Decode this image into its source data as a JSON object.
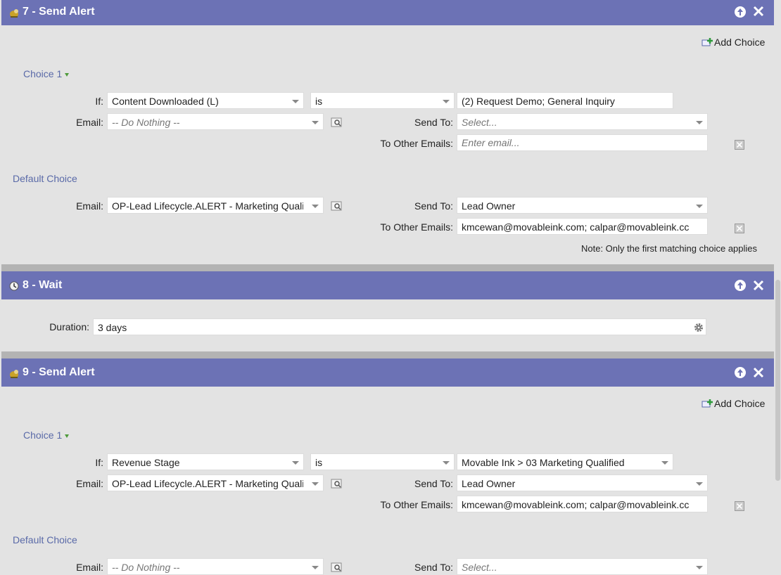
{
  "steps": [
    {
      "title": "7 - Send Alert",
      "add_choice": "Add Choice",
      "choice1": {
        "label": "Choice 1",
        "if_label": "If:",
        "attribute": "Content Downloaded (L)",
        "operator": "is",
        "value": "(2) Request Demo; General Inquiry",
        "email_label": "Email:",
        "email_value": "-- Do Nothing --",
        "send_to_label": "Send To:",
        "send_to_value": "Select...",
        "other_emails_label": "To Other Emails:",
        "other_emails_placeholder": "Enter email..."
      },
      "default_choice": {
        "label": "Default Choice",
        "email_label": "Email:",
        "email_value": "OP-Lead Lifecycle.ALERT - Marketing Qualif",
        "send_to_label": "Send To:",
        "send_to_value": "Lead Owner",
        "other_emails_label": "To Other Emails:",
        "other_emails_value": "kmcewan@movableink.com; calpar@movableink.cc"
      },
      "note": "Note: Only the first matching choice applies"
    },
    {
      "title": "8 - Wait",
      "duration_label": "Duration:",
      "duration_value": "3 days"
    },
    {
      "title": "9 - Send Alert",
      "add_choice": "Add Choice",
      "choice1": {
        "label": "Choice 1",
        "if_label": "If:",
        "attribute": "Revenue Stage",
        "operator": "is",
        "value": "Movable Ink > 03 Marketing Qualified",
        "email_label": "Email:",
        "email_value": "OP-Lead Lifecycle.ALERT - Marketing Qualif",
        "send_to_label": "Send To:",
        "send_to_value": "Lead Owner",
        "other_emails_label": "To Other Emails:",
        "other_emails_value": "kmcewan@movableink.com; calpar@movableink.cc"
      },
      "default_choice": {
        "label": "Default Choice",
        "email_label": "Email:",
        "email_value": "-- Do Nothing --",
        "send_to_label": "Send To:",
        "send_to_value": "Select..."
      }
    }
  ],
  "icons": {
    "send_alert": "alert-icon",
    "wait": "clock-icon",
    "move_up": "arrow-up-icon",
    "delete_step": "close-icon",
    "preview": "preview-icon",
    "remove_choice": "remove-icon",
    "settings": "gear-icon",
    "add_choice": "add-choice-icon"
  },
  "colors": {
    "header": "#6c72b5",
    "panel": "#e3e3e3",
    "separator": "#b3b3b3",
    "link": "#5a6aa8"
  }
}
